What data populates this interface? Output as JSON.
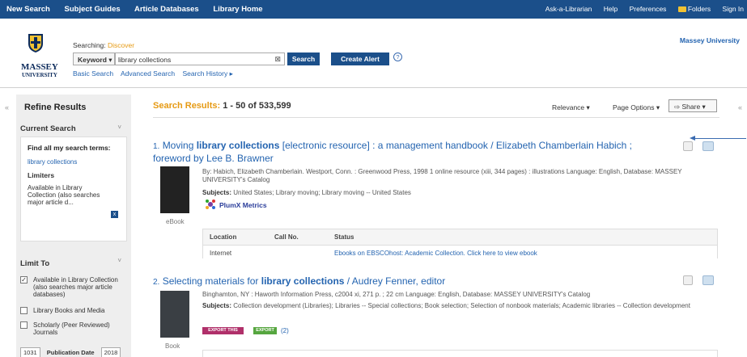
{
  "topnav": {
    "left": [
      "New Search",
      "Subject Guides",
      "Article Databases",
      "Library Home"
    ],
    "right": [
      "Ask-a-Librarian",
      "Help",
      "Preferences",
      "Folders",
      "Sign In"
    ]
  },
  "header": {
    "logo_name": "MASSEY",
    "logo_sub": "UNIVERSITY",
    "searching_label": "Searching:",
    "searching_db": "Discover",
    "field_select": "Keyword",
    "query": "library collections",
    "search_button": "Search",
    "alert_button": "Create Alert",
    "help_icon": "?",
    "links": [
      "Basic Search",
      "Advanced Search",
      "Search History ▸"
    ],
    "institution": "Massey University"
  },
  "sidebar": {
    "title": "Refine Results",
    "current_search_heading": "Current Search",
    "find_all_heading": "Find all my search terms:",
    "term": "library collections",
    "limiters_heading": "Limiters",
    "limiter_text": "Available in Library Collection (also searches major article d...",
    "limit_to_heading": "Limit To",
    "limit_options": [
      {
        "label": "Available in Library Collection (also searches major article databases)",
        "checked": true
      },
      {
        "label": "Library Books and Media",
        "checked": false
      },
      {
        "label": "Scholarly (Peer Reviewed) Journals",
        "checked": false
      }
    ],
    "date_from": "1031",
    "date_label": "Publication Date",
    "date_to": "2018"
  },
  "results": {
    "label": "Search Results:",
    "range": "1 - 50 of 533,599",
    "relevance": "Relevance ▾",
    "page_options": "Page Options ▾",
    "share": "Share ▾",
    "items": [
      {
        "num": "1.",
        "title_pre": "Moving ",
        "title_bold": "library collections",
        "title_post": " [electronic resource] : a management handbook / Elizabeth Chamberlain Habich ; foreword by Lee B. Brawner",
        "byline": "By: Habich, Elizabeth Chamberlain. Westport, Conn. : Greenwood Press, 1998 1 online resource (xiii, 344 pages) : illustrations Language: English, Database: MASSEY UNIVERSITY's Catalog",
        "subjects_label": "Subjects:",
        "subjects": "United States; Library moving; Library moving -- United States",
        "type": "eBook",
        "plumx": "PlumX Metrics",
        "avail_headers": [
          "Location",
          "Call No.",
          "Status"
        ],
        "avail_row": {
          "location": "Internet",
          "callno": "",
          "status": "Ebooks on EBSCOhost: Academic Collection. Click here to view ebook"
        }
      },
      {
        "num": "2.",
        "title_pre": "Selecting materials for ",
        "title_bold": "library collections",
        "title_post": " / Audrey Fenner, editor",
        "byline": "Binghamton, NY : Haworth Information Press, c2004 xi, 271 p. ; 22 cm Language: English, Database: MASSEY UNIVERSITY's Catalog",
        "subjects_label": "Subjects:",
        "subjects": "Collection development (Libraries); Libraries -- Special collections; Book selection; Selection of nonbook materials; Academic libraries -- Collection development",
        "type": "Book",
        "badge_export": "EXPORT THIS",
        "badge_green": "EXPORT",
        "badge_count": "(2)"
      }
    ]
  },
  "colors": {
    "nav": "#1b4f8a",
    "link": "#2464b0",
    "accent": "#e69a13"
  }
}
